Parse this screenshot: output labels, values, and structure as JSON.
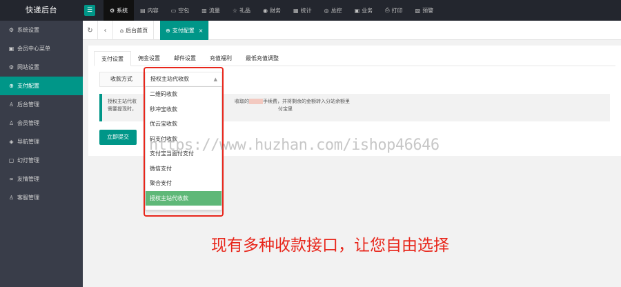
{
  "app": {
    "title": "快递后台",
    "menu_icon": "list-icon"
  },
  "colors": {
    "accent": "#009688",
    "selected": "#5fb878",
    "annotation": "#e8261b",
    "topbar": "#23262e",
    "sidebar": "#393d49"
  },
  "topnav": [
    {
      "label": "系统",
      "icon": "gear-icon",
      "active": true
    },
    {
      "label": "内容",
      "icon": "document-icon"
    },
    {
      "label": "空包",
      "icon": "box-icon"
    },
    {
      "label": "流量",
      "icon": "chart-icon"
    },
    {
      "label": "礼品",
      "icon": "star-icon"
    },
    {
      "label": "财务",
      "icon": "wallet-icon"
    },
    {
      "label": "统计",
      "icon": "stats-icon"
    },
    {
      "label": "总控",
      "icon": "control-icon"
    },
    {
      "label": "业务",
      "icon": "briefcase-icon"
    },
    {
      "label": "打印",
      "icon": "printer-icon"
    },
    {
      "label": "预警",
      "icon": "warning-icon"
    }
  ],
  "sidebar": [
    {
      "label": "系统设置",
      "icon": "gear-icon"
    },
    {
      "label": "会员中心菜单",
      "icon": "menu-icon"
    },
    {
      "label": "网站设置",
      "icon": "gear-icon"
    },
    {
      "label": "支付配置",
      "icon": "lock-icon",
      "active": true
    },
    {
      "label": "后台管理",
      "icon": "user-icon"
    },
    {
      "label": "会员管理",
      "icon": "users-icon"
    },
    {
      "label": "导航管理",
      "icon": "nav-icon"
    },
    {
      "label": "幻灯管理",
      "icon": "slides-icon"
    },
    {
      "label": "友情管理",
      "icon": "link-icon"
    },
    {
      "label": "客服管理",
      "icon": "support-icon"
    }
  ],
  "tabsbar": {
    "refresh_icon": "refresh-icon",
    "back_icon": "chevron-left-icon",
    "tabs": [
      {
        "label": "后台首页",
        "icon": "home-icon"
      },
      {
        "label": "支付配置",
        "icon": "lock-icon",
        "active": true,
        "close": "×"
      }
    ]
  },
  "subtabs": [
    "支付设置",
    "佣金设置",
    "邮件设置",
    "充值福利",
    "最低充值调整"
  ],
  "form": {
    "label": "收款方式",
    "selected": "授权主站代收款",
    "notice_line1_a": "授权主站代收",
    "notice_line1_b": "收取的",
    "notice_line1_c": "手续费，并将剩余的金额转入分站余额里",
    "notice_line2_a": "需要提现时，",
    "notice_line2_b": "付宝里",
    "submit": "立即提交"
  },
  "dropdown": {
    "options": [
      "二维码收款",
      "秒冲宝收款",
      "优云宝收款",
      "码支付收款",
      "支付宝当面付支付",
      "微信支付",
      "聚合支付",
      "授权主站代收款"
    ],
    "selected_index": 7
  },
  "watermark": "https://www.huzhan.com/ishop46646",
  "promo": "现有多种收款接口，让您自由选择"
}
